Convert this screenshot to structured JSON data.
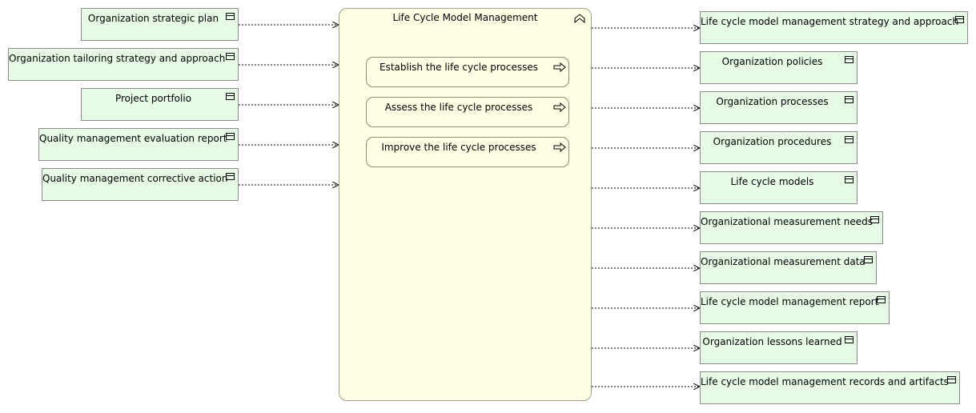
{
  "process": {
    "title": "Life Cycle Model Management",
    "subprocesses": [
      "Establish the life cycle processes",
      "Assess the life cycle processes",
      "Improve the life cycle processes"
    ]
  },
  "inputs": [
    "Organization strategic plan",
    "Organization tailoring strategy and approach",
    "Project portfolio",
    "Quality management evaluation report",
    "Quality management corrective action"
  ],
  "outputs": [
    "Life cycle model management strategy and approach",
    "Organization policies",
    "Organization processes",
    "Organization procedures",
    "Life cycle models",
    "Organizational measurement needs",
    "Organizational measurement data",
    "Life cycle model management report",
    "Organization lessons learned",
    "Life cycle model management records and artifacts"
  ],
  "colors": {
    "object_fill": "#e6fae6",
    "process_fill": "#ffffe6",
    "border": "#8c8c8c"
  },
  "icons": {
    "object": "business-object-icon",
    "process": "process-arrow-icon",
    "collapse": "chevron-up-icon"
  }
}
